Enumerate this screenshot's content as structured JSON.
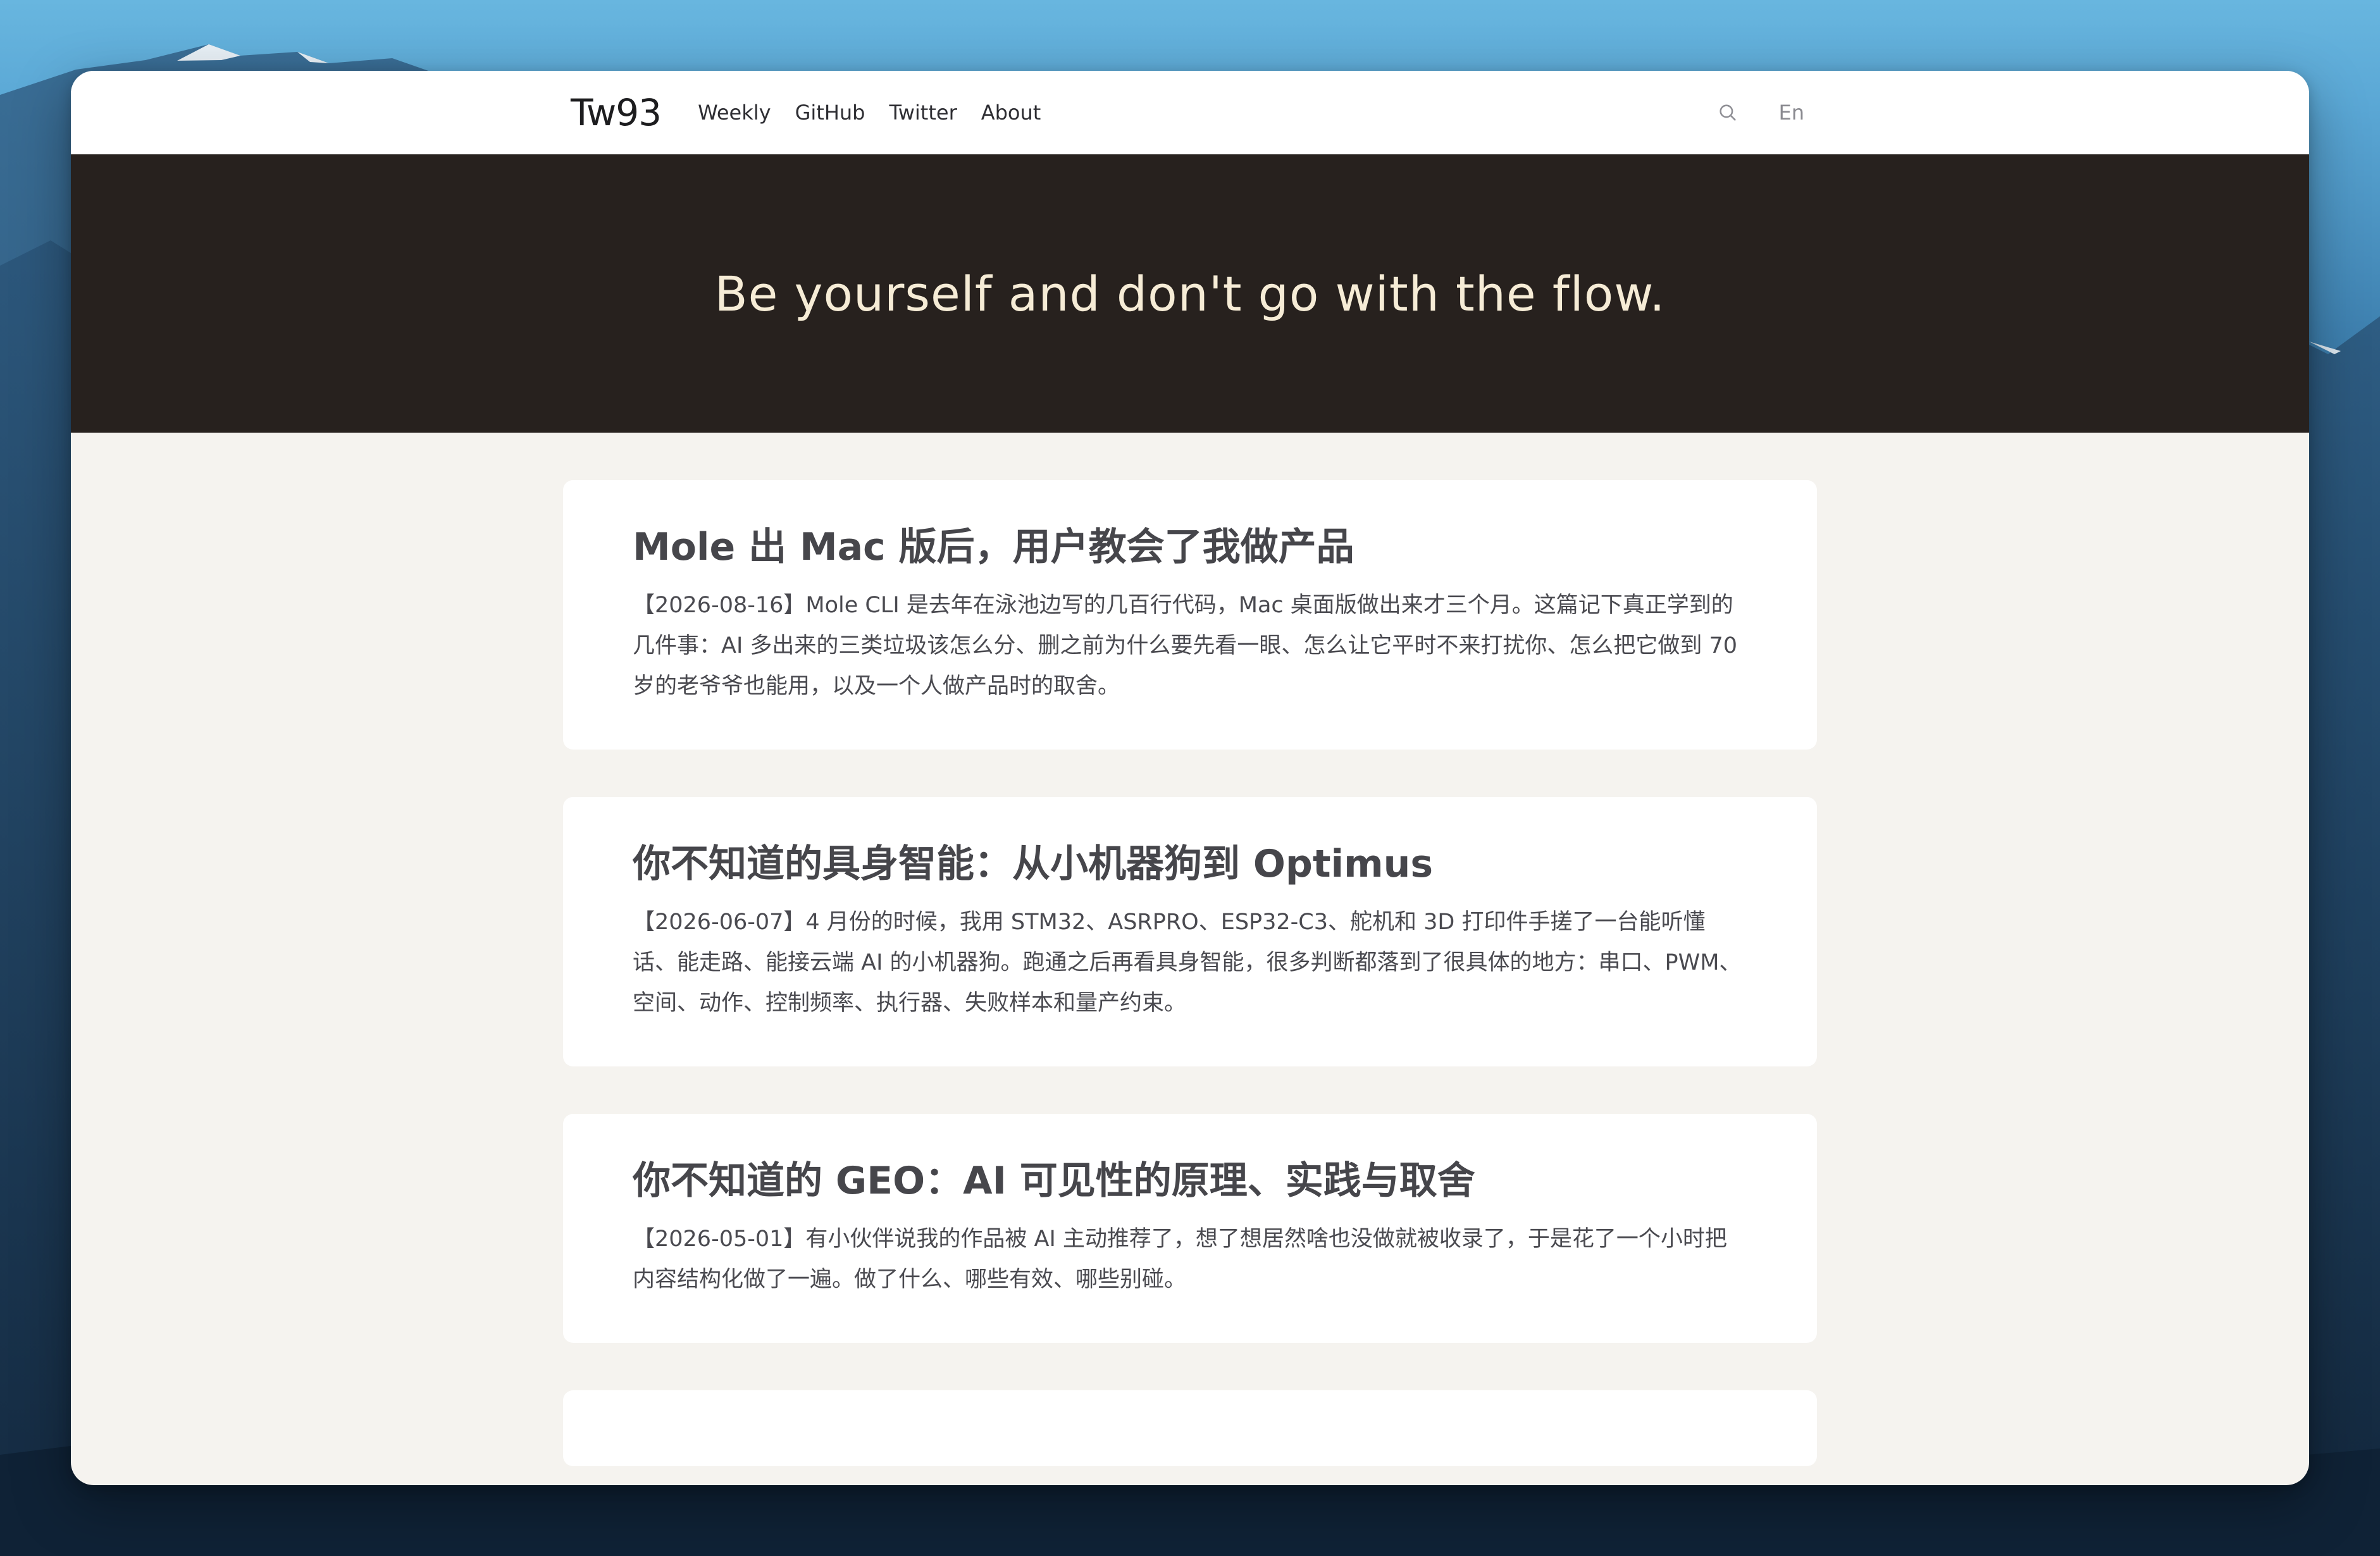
{
  "site": {
    "brand": "Tw93",
    "nav": [
      "Weekly",
      "GitHub",
      "Twitter",
      "About"
    ],
    "search_icon": "search-icon",
    "language": "En"
  },
  "hero": {
    "tagline": "Be yourself and don't go with the flow."
  },
  "posts": [
    {
      "title": "Mole 出 Mac 版后，用户教会了我做产品",
      "excerpt": "【2026-08-16】Mole CLI 是去年在泳池边写的几百行代码，Mac 桌面版做出来才三个月。这篇记下真正学到的几件事：AI 多出来的三类垃圾该怎么分、删之前为什么要先看一眼、怎么让它平时不来打扰你、怎么把它做到 70 岁的老爷爷也能用，以及一个人做产品时的取舍。"
    },
    {
      "title": "你不知道的具身智能：从小机器狗到 Optimus",
      "excerpt": "【2026-06-07】4 月份的时候，我用 STM32、ASRPRO、ESP32-C3、舵机和 3D 打印件手搓了一台能听懂话、能走路、能接云端 AI 的小机器狗。跑通之后再看具身智能，很多判断都落到了很具体的地方：串口、PWM、空间、动作、控制频率、执行器、失败样本和量产约束。"
    },
    {
      "title": "你不知道的 GEO：AI 可见性的原理、实践与取舍",
      "excerpt": "【2026-05-01】有小伙伴说我的作品被 AI 主动推荐了，想了想居然啥也没做就被收录了，于是花了一个小时把内容结构化做了一遍。做了什么、哪些有效、哪些别碰。"
    }
  ],
  "colors": {
    "hero_bg": "#27211e",
    "hero_text": "#f6ecd6",
    "page_bg": "#f5f3ef",
    "card_bg": "#ffffff"
  }
}
